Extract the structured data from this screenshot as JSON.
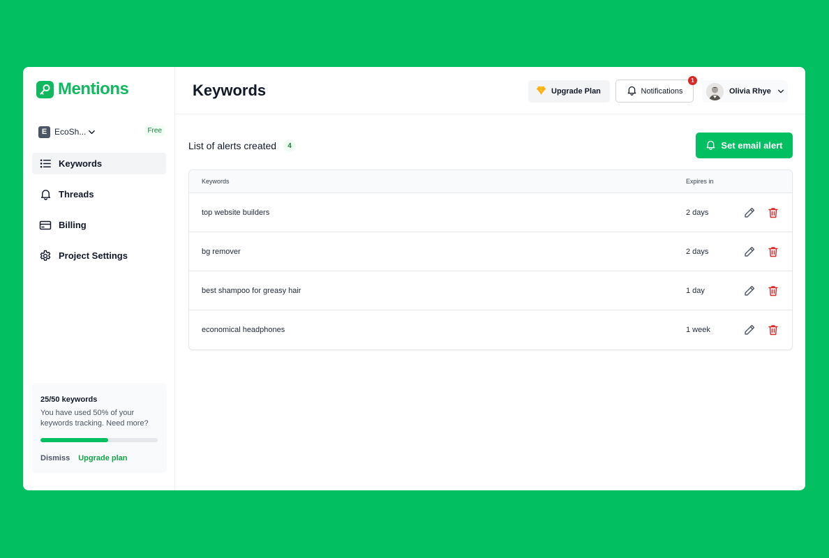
{
  "app": {
    "name": "Mentions",
    "brand_color": "#02bf62"
  },
  "workspace": {
    "initial": "E",
    "name": "EcoSh...",
    "plan_badge": "Free"
  },
  "sidebar": {
    "items": [
      {
        "label": "Keywords",
        "icon": "list-icon",
        "active": true
      },
      {
        "label": "Threads",
        "icon": "bell-icon",
        "active": false
      },
      {
        "label": "Billing",
        "icon": "credit-card-icon",
        "active": false
      },
      {
        "label": "Project Settings",
        "icon": "gear-icon",
        "active": false
      }
    ]
  },
  "usage": {
    "title": "25/50 keywords",
    "description": "You have used 50% of your keywords tracking. Need more?",
    "progress_fraction": 0.58,
    "dismiss_label": "Dismiss",
    "upgrade_label": "Upgrade plan"
  },
  "header": {
    "title": "Keywords",
    "upgrade_label": "Upgrade Plan",
    "notifications_label": "Notifications",
    "notifications_count": "1",
    "user_name": "Olivia Rhye"
  },
  "alerts": {
    "title": "List of alerts created",
    "count": "4",
    "set_alert_label": "Set email alert",
    "columns": [
      "Keywords",
      "Expires in"
    ],
    "rows": [
      {
        "keyword": "top website builders",
        "expires": "2 days"
      },
      {
        "keyword": "bg remover",
        "expires": "2 days"
      },
      {
        "keyword": "best shampoo for greasy hair",
        "expires": "1 day"
      },
      {
        "keyword": "economical headphones",
        "expires": "1 week"
      }
    ]
  }
}
